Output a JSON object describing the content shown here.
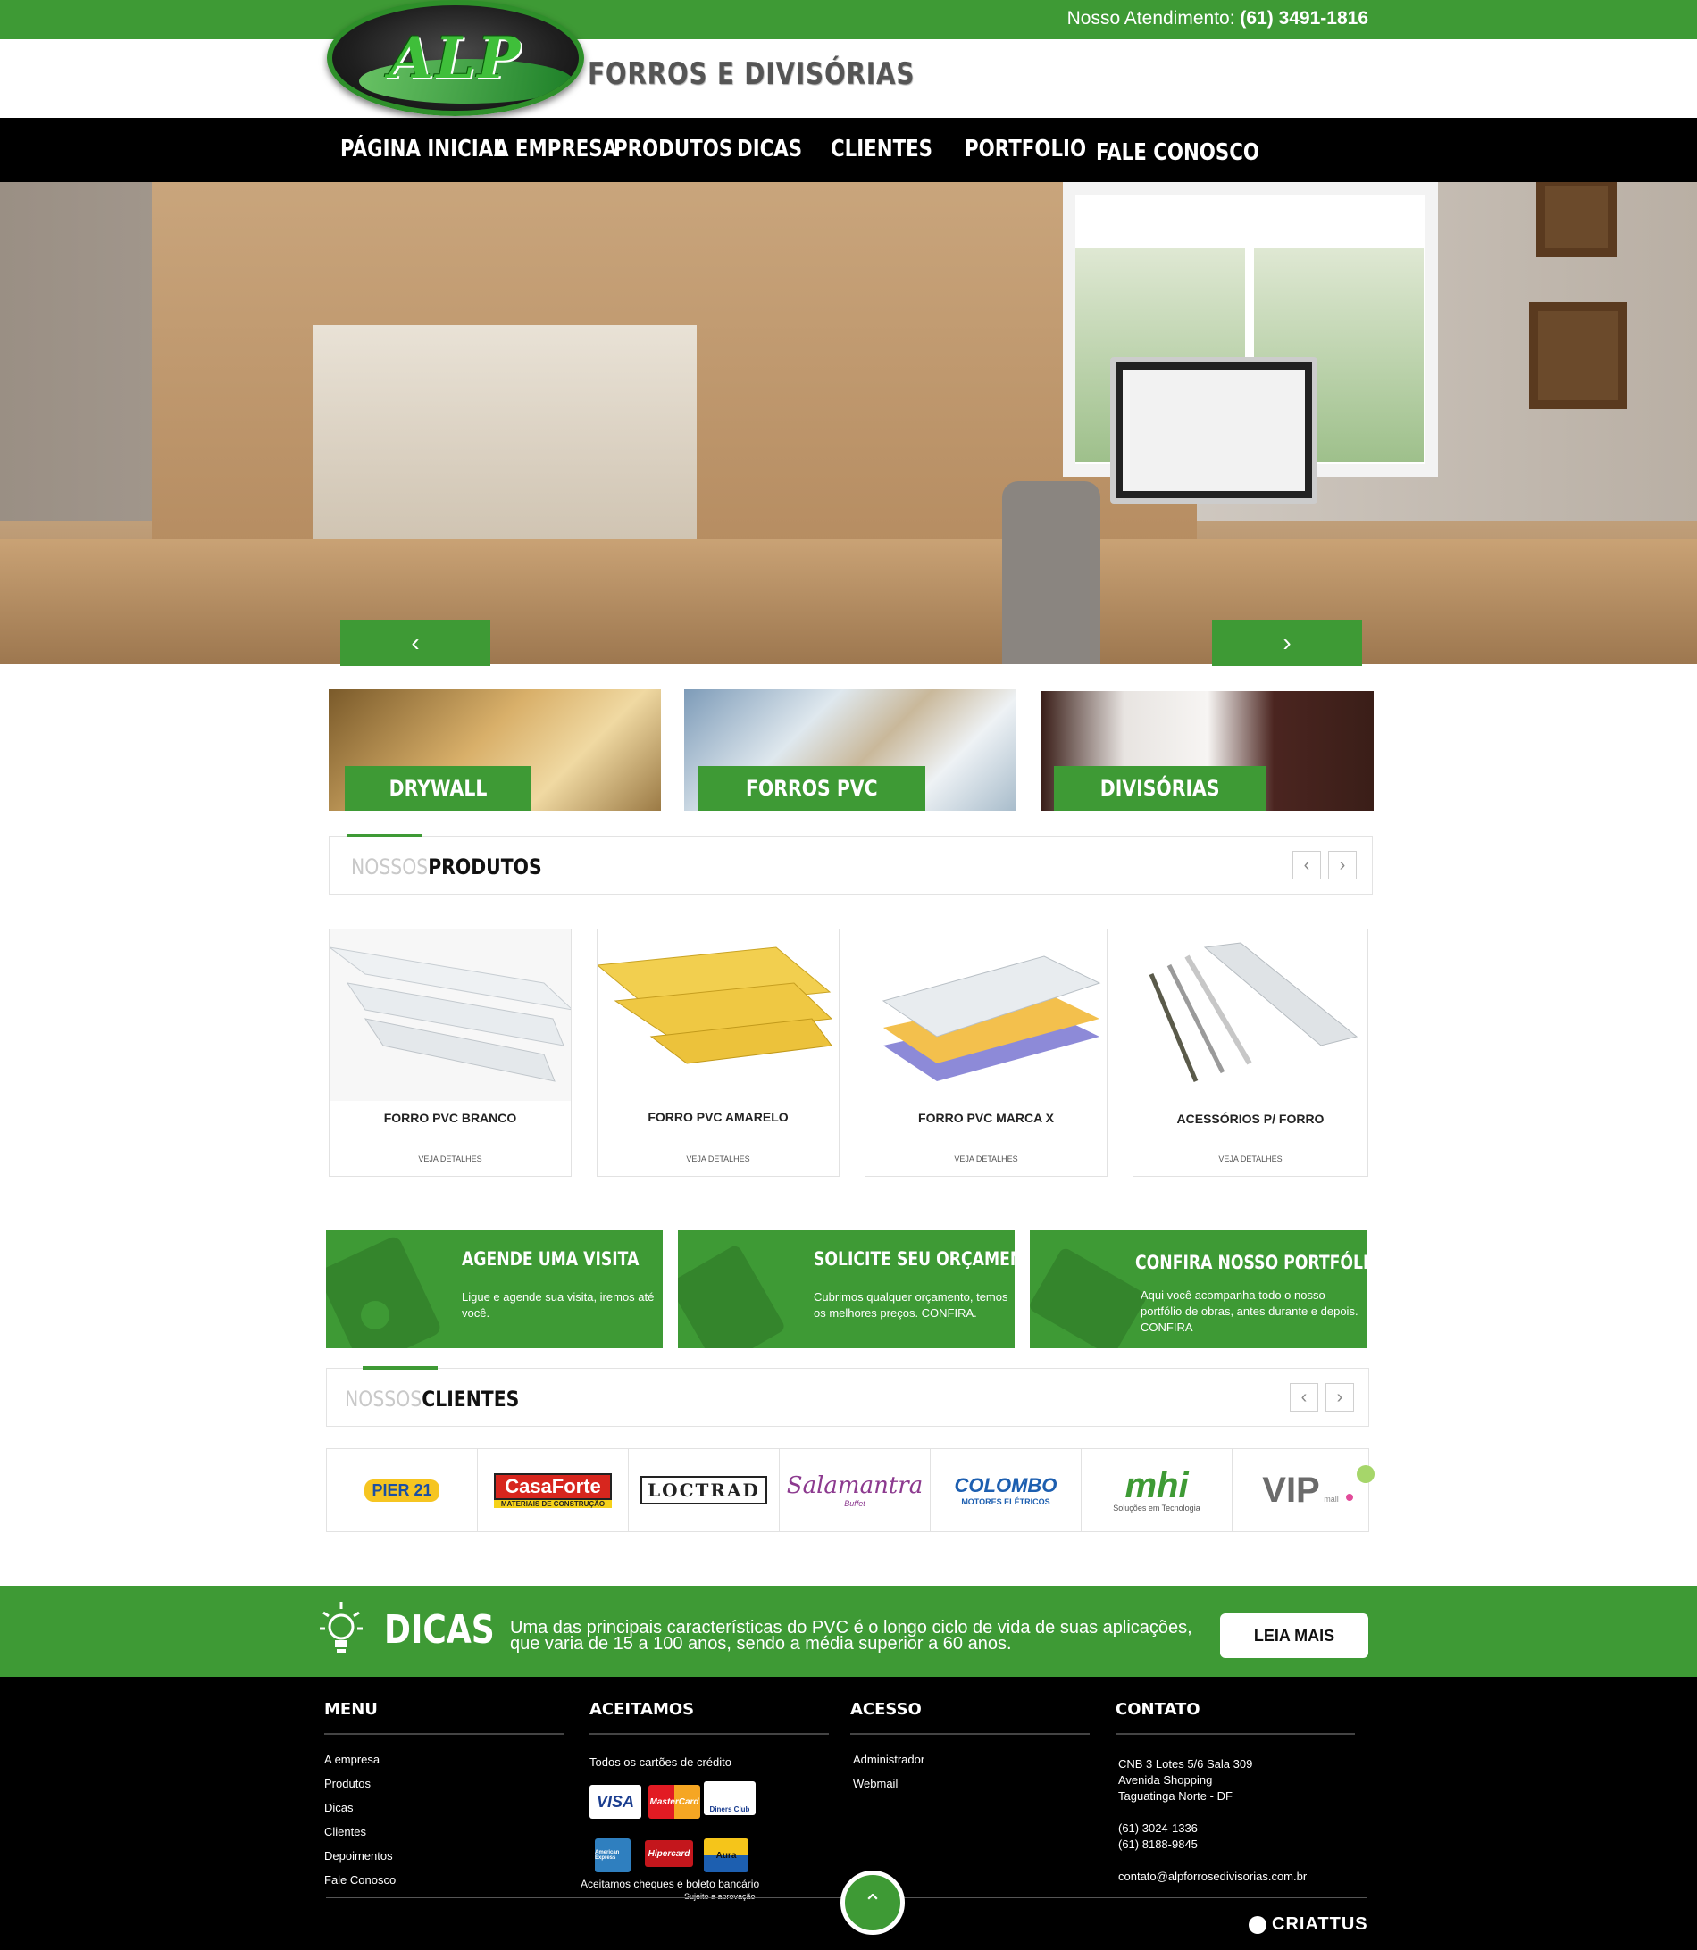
{
  "topbar": {
    "label": "Nosso Atendimento:",
    "phone": "(61) 3491-1816"
  },
  "brand": {
    "logo_text": "ALP",
    "subtitle": "FORROS E DIVISÓRIAS"
  },
  "nav": {
    "items": [
      {
        "label": "PÁGINA INICIAL"
      },
      {
        "label": "A EMPRESA"
      },
      {
        "label": "PRODUTOS"
      },
      {
        "label": "DICAS"
      },
      {
        "label": "CLIENTES"
      },
      {
        "label": "PORTFOLIO"
      },
      {
        "label": "FALE CONOSCO"
      }
    ]
  },
  "hero": {
    "prev": "‹",
    "next": "›"
  },
  "categories": [
    {
      "label": "DRYWALL"
    },
    {
      "label": "FORROS PVC"
    },
    {
      "label": "DIVISÓRIAS"
    }
  ],
  "products_section": {
    "light": "NOSSOS",
    "bold": "PRODUTOS"
  },
  "products": [
    {
      "name": "FORRO PVC BRANCO",
      "more": "VEJA DETALHES"
    },
    {
      "name": "FORRO PVC AMARELO",
      "more": "VEJA DETALHES"
    },
    {
      "name": "FORRO PVC MARCA X",
      "more": "VEJA DETALHES"
    },
    {
      "name": "ACESSÓRIOS P/ FORRO",
      "more": "VEJA DETALHES"
    }
  ],
  "cta": [
    {
      "title": "AGENDE UMA VISITA",
      "desc": "Ligue e agende sua visita, iremos até você."
    },
    {
      "title": "SOLICITE SEU ORÇAMENTO",
      "desc": "Cubrimos qualquer orçamento, temos os melhores preços. CONFIRA."
    },
    {
      "title": "CONFIRA NOSSO PORTFÓLIO",
      "desc": "Aqui você acompanha todo o nosso portfólio de obras, antes durante e depois. CONFIRA"
    }
  ],
  "clients_section": {
    "light": "NOSSOS",
    "bold": "CLIENTES"
  },
  "clients": [
    {
      "name": "PIER 21"
    },
    {
      "name": "CasaForte",
      "sub": "MATERIAIS DE CONSTRUÇÃO"
    },
    {
      "name": "LOCTRAD"
    },
    {
      "name": "Salamantra",
      "sub": "Buffet"
    },
    {
      "name": "COLOMBO",
      "sub": "MOTORES ELÉTRICOS"
    },
    {
      "name": "mhi",
      "sub": "Soluções em Tecnologia"
    },
    {
      "name": "VIP",
      "sub": "mall"
    }
  ],
  "dicas": {
    "title": "DICAS",
    "text": "Uma das principais características do PVC é o longo ciclo de vida de  suas aplicações, que varia de 15 a 100 anos, sendo a média superior a 60 anos.",
    "button": "LEIA MAIS"
  },
  "footer": {
    "menu": {
      "title": "MENU",
      "items": [
        "A empresa",
        "Produtos",
        "Dicas",
        "Clientes",
        "Depoimentos",
        "Fale Conosco"
      ]
    },
    "aceitamos": {
      "title": "ACEITAMOS",
      "intro": "Todos os cartões de crédito",
      "cards": [
        "VISA",
        "MasterCard",
        "Diners Club",
        "American Express",
        "Hipercard",
        "Aura"
      ],
      "note": "Aceitamos cheques e boleto bancário",
      "note_small": "Sujeito a aprovação"
    },
    "acesso": {
      "title": "ACESSO",
      "items": [
        "Administrador",
        "Webmail"
      ]
    },
    "contato": {
      "title": "CONTATO",
      "address1": "CNB 3 Lotes 5/6 Sala 309",
      "address2": "Avenida Shopping",
      "address3": "Taguatinga Norte - DF",
      "phone1": "(61) 3024-1336",
      "phone2": "(61) 8188-9845",
      "email": "contato@alpforrosedivisorias.com.br"
    },
    "to_top": "⌃",
    "credit": "CRIATTUS"
  },
  "colors": {
    "accent": "#3e9a35",
    "nav_bg": "#000000",
    "footer_bg": "#000000"
  }
}
